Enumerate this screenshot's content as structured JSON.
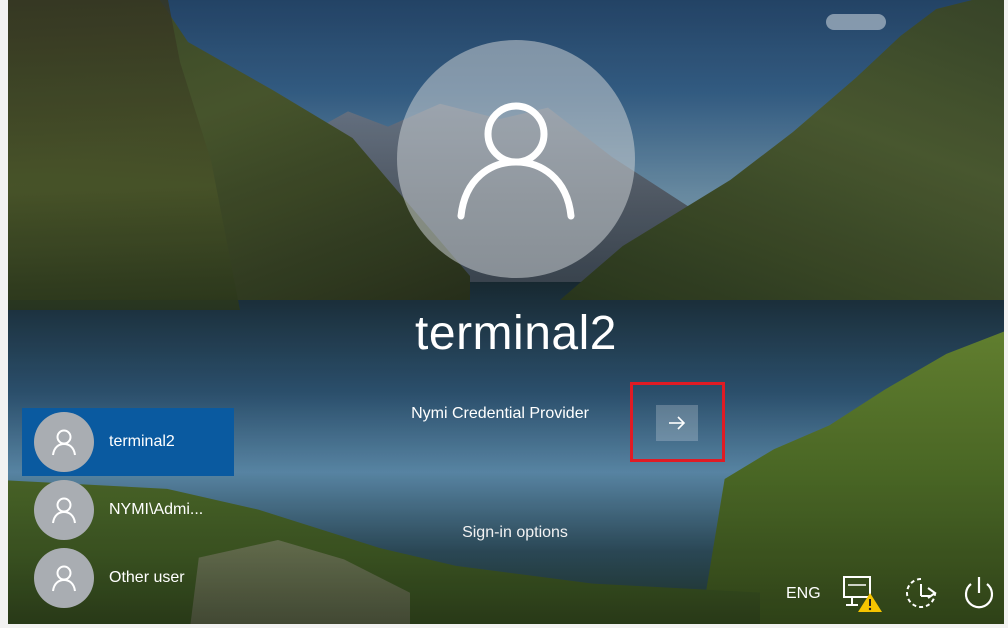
{
  "login": {
    "username": "terminal2",
    "credential_provider": "Nymi Credential Provider",
    "submit_icon": "arrow-right-icon",
    "sign_in_options": "Sign-in options"
  },
  "user_list": {
    "items": [
      {
        "label": "terminal2",
        "selected": true,
        "icon": "user-icon"
      },
      {
        "label": "NYMI\\Admi...",
        "selected": false,
        "icon": "user-icon"
      },
      {
        "label": "Other user",
        "selected": false,
        "icon": "user-icon"
      }
    ]
  },
  "system_tray": {
    "language": "ENG",
    "network_icon": "network-warning-icon",
    "accessibility_icon": "ease-of-access-icon",
    "power_icon": "power-icon"
  },
  "colors": {
    "selected_user_bg": "#0a5aa0",
    "highlight_border": "#e01b24",
    "warning": "#f5c400"
  }
}
